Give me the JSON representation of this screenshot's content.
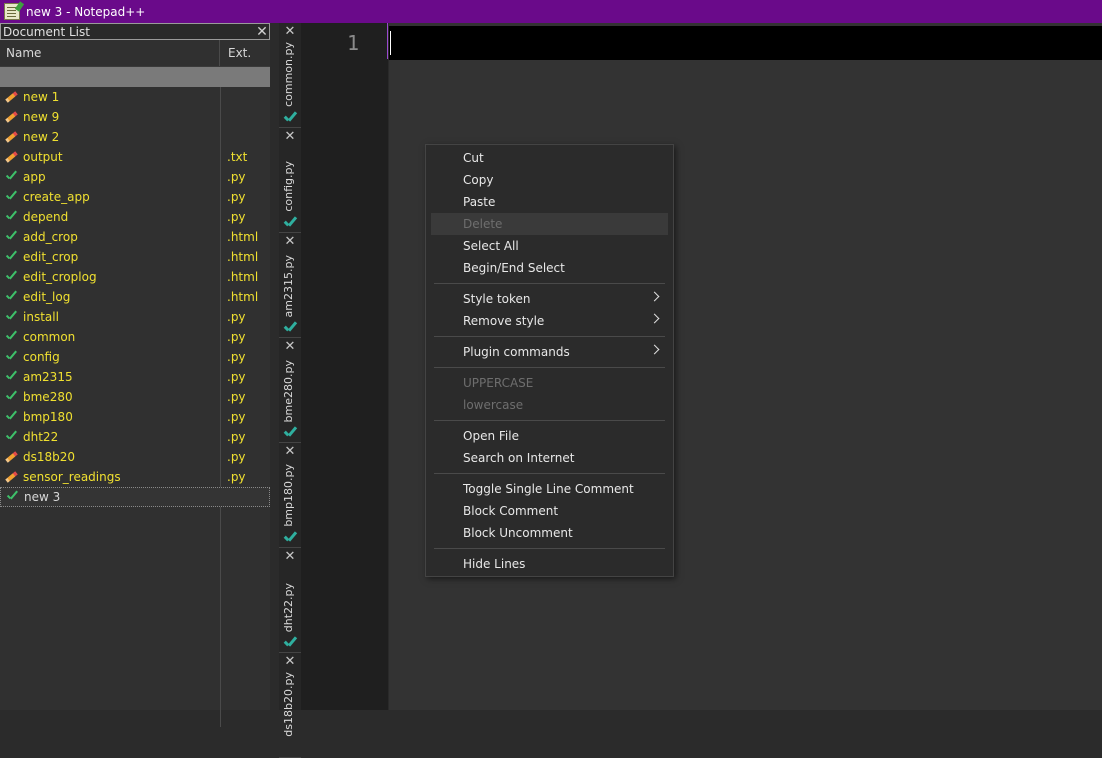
{
  "window": {
    "title": "new 3 - Notepad++"
  },
  "doc_list": {
    "title": "Document List",
    "col_name": "Name",
    "col_ext": "Ext.",
    "rows": [
      {
        "name": "new 1",
        "ext": "",
        "icon": "pencil-icon"
      },
      {
        "name": "new 9",
        "ext": "",
        "icon": "pencil-icon"
      },
      {
        "name": "new 2",
        "ext": "",
        "icon": "pencil-icon"
      },
      {
        "name": "output",
        "ext": ".txt",
        "icon": "pencil-icon"
      },
      {
        "name": "app",
        "ext": ".py",
        "icon": "check-icon"
      },
      {
        "name": "create_app",
        "ext": ".py",
        "icon": "check-icon"
      },
      {
        "name": "depend",
        "ext": ".py",
        "icon": "check-icon"
      },
      {
        "name": "add_crop",
        "ext": ".html",
        "icon": "check-icon"
      },
      {
        "name": "edit_crop",
        "ext": ".html",
        "icon": "check-icon"
      },
      {
        "name": "edit_croplog",
        "ext": ".html",
        "icon": "check-icon"
      },
      {
        "name": "edit_log",
        "ext": ".html",
        "icon": "check-icon"
      },
      {
        "name": "install",
        "ext": ".py",
        "icon": "check-icon"
      },
      {
        "name": "common",
        "ext": ".py",
        "icon": "check-icon"
      },
      {
        "name": "config",
        "ext": ".py",
        "icon": "check-icon"
      },
      {
        "name": "am2315",
        "ext": ".py",
        "icon": "check-icon"
      },
      {
        "name": "bme280",
        "ext": ".py",
        "icon": "check-icon"
      },
      {
        "name": "bmp180",
        "ext": ".py",
        "icon": "check-icon"
      },
      {
        "name": "dht22",
        "ext": ".py",
        "icon": "check-icon"
      },
      {
        "name": "ds18b20",
        "ext": ".py",
        "icon": "pencil-icon"
      },
      {
        "name": "sensor_readings",
        "ext": ".py",
        "icon": "pencil-icon"
      },
      {
        "name": "new 3",
        "ext": "",
        "icon": "check-icon",
        "selected": true
      }
    ]
  },
  "tabs": [
    {
      "label": "common.py"
    },
    {
      "label": "config.py"
    },
    {
      "label": "am2315.py"
    },
    {
      "label": "bme280.py"
    },
    {
      "label": "bmp180.py"
    },
    {
      "label": "dht22.py"
    },
    {
      "label": "ds18b20.py"
    }
  ],
  "editor": {
    "line_number": "1"
  },
  "context_menu": {
    "items": [
      {
        "label": "Cut"
      },
      {
        "label": "Copy"
      },
      {
        "label": "Paste"
      },
      {
        "label": "Delete",
        "disabled": true
      },
      {
        "label": "Select All"
      },
      {
        "label": "Begin/End Select"
      },
      {
        "label": "Style token",
        "submenu": true
      },
      {
        "label": "Remove style",
        "submenu": true
      },
      {
        "label": "Plugin commands",
        "submenu": true
      },
      {
        "label": "UPPERCASE",
        "disabled": true
      },
      {
        "label": "lowercase",
        "disabled": true
      },
      {
        "label": "Open File"
      },
      {
        "label": "Search on Internet"
      },
      {
        "label": "Toggle Single Line Comment"
      },
      {
        "label": "Block Comment"
      },
      {
        "label": "Block Uncomment"
      },
      {
        "label": "Hide Lines"
      }
    ]
  },
  "colors": {
    "titlebar": "#6a0a8a",
    "doc_name_text": "#f0e030",
    "check_green": "#3ec06a"
  }
}
